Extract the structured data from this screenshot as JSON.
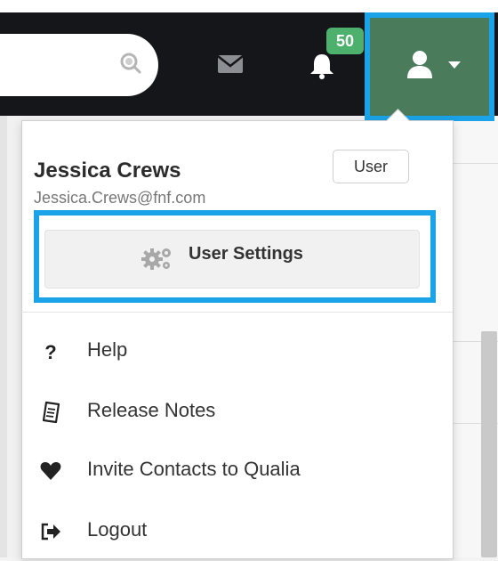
{
  "topbar": {
    "search": {
      "icon": "search-icon"
    },
    "mail": {
      "icon": "envelope-icon"
    },
    "notifications": {
      "icon": "bell-icon",
      "count": "50",
      "badge_color": "#4db06c"
    },
    "user_menu": {
      "icon": "user-icon",
      "caret": "caret-down-icon",
      "bg_color": "#4a7b5b"
    },
    "highlight_color": "#1aa3e8"
  },
  "dropdown": {
    "user": {
      "name": "Jessica Crews",
      "email": "Jessica.Crews@fnf.com",
      "role": "User"
    },
    "settings_button": {
      "icon": "gears-icon",
      "label": "User Settings"
    },
    "items": [
      {
        "icon": "question-icon",
        "label": "Help"
      },
      {
        "icon": "document-icon",
        "label": "Release Notes"
      },
      {
        "icon": "heart-icon",
        "label": "Invite Contacts to Qualia"
      },
      {
        "icon": "logout-icon",
        "label": "Logout"
      }
    ]
  }
}
